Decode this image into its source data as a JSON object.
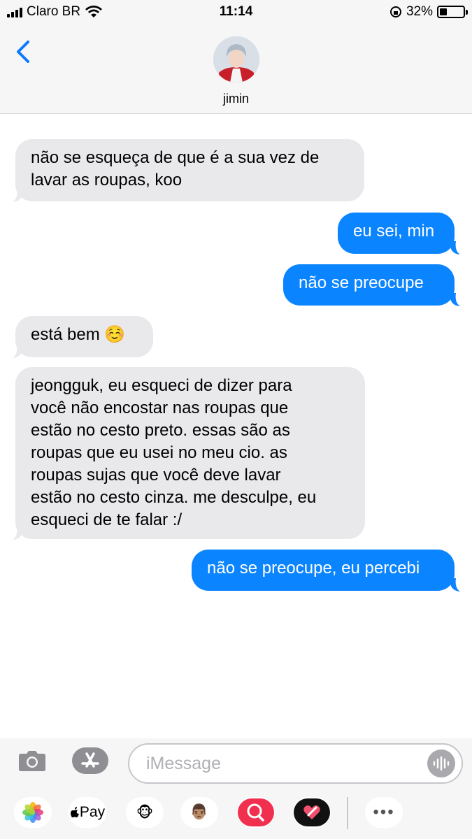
{
  "status_bar": {
    "carrier": "Claro BR",
    "time": "11:14",
    "battery_percent": "32%",
    "battery_level": 0.32
  },
  "header": {
    "contact_name": "jimin",
    "back_icon": "chevron-left-icon",
    "avatar": "contact-photo"
  },
  "messages": [
    {
      "from": "them",
      "text": "não se esqueça de que é a sua vez de\nlavar as roupas, koo"
    },
    {
      "from": "me",
      "text": "eu sei, min"
    },
    {
      "from": "me",
      "text": "não se preocupe"
    },
    {
      "from": "them",
      "text": "está bem ☺️"
    },
    {
      "from": "them",
      "text": "jeongguk, eu esqueci de dizer para\nvocê não encostar nas roupas que\nestão no cesto preto. essas são as\nroupas que eu usei no meu cio. as\nroupas sujas que você deve lavar\nestão no cesto cinza. me desculpe, eu\nesqueci de te falar :/"
    },
    {
      "from": "me",
      "text": "não se preocupe, eu percebi"
    }
  ],
  "input_bar": {
    "placeholder": "iMessage",
    "value": "",
    "camera_icon": "camera-icon",
    "app_store_icon": "app-store-icon",
    "audio_icon": "audio-waveform-icon",
    "apps": [
      {
        "name": "photos-icon",
        "label": ""
      },
      {
        "name": "apple-pay-icon",
        "label": "Pay"
      },
      {
        "name": "animoji-icon",
        "label": "🐵"
      },
      {
        "name": "memoji-icon",
        "label": "👨🏽"
      },
      {
        "name": "search-images-icon",
        "label": ""
      },
      {
        "name": "digital-touch-icon",
        "label": ""
      },
      {
        "name": "more-icon",
        "label": "•••"
      }
    ]
  },
  "colors": {
    "sent_bubble": "#0b84ff",
    "received_bubble": "#e9e9eb",
    "tint": "#0a7aff"
  }
}
